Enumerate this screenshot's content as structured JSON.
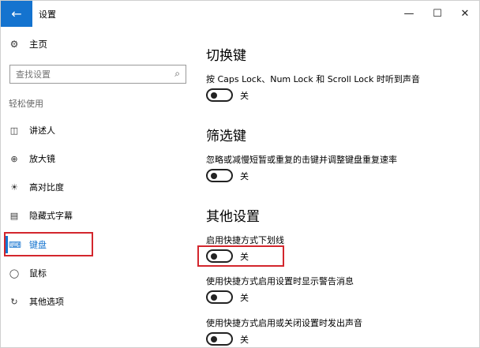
{
  "window": {
    "title": "设置",
    "back_icon": "arrow-left-icon",
    "minimize": "—",
    "maximize": "☐",
    "close": "✕"
  },
  "sidebar": {
    "home_label": "主页",
    "search_placeholder": "查找设置",
    "group_label": "轻松使用",
    "items": [
      {
        "label": "讲述人",
        "icon": "narrator-icon"
      },
      {
        "label": "放大镜",
        "icon": "magnifier-icon"
      },
      {
        "label": "高对比度",
        "icon": "contrast-icon"
      },
      {
        "label": "隐藏式字幕",
        "icon": "captions-icon"
      },
      {
        "label": "键盘",
        "icon": "keyboard-icon",
        "selected": true
      },
      {
        "label": "鼠标",
        "icon": "mouse-icon"
      },
      {
        "label": "其他选项",
        "icon": "other-options-icon"
      }
    ],
    "accent": "#1473cf"
  },
  "main": {
    "sections": [
      {
        "heading": "切换键",
        "settings": [
          {
            "desc": "按 Caps Lock、Num Lock 和 Scroll Lock 时听到声音",
            "state": "关",
            "on": false
          }
        ]
      },
      {
        "heading": "筛选键",
        "settings": [
          {
            "desc": "忽略或减慢短暂或重复的击键并调整键盘重复速率",
            "state": "关",
            "on": false
          }
        ]
      },
      {
        "heading": "其他设置",
        "settings": [
          {
            "desc": "启用快捷方式下划线",
            "state": "关",
            "on": false
          },
          {
            "desc": "使用快捷方式启用设置时显示警告消息",
            "state": "关",
            "on": false
          },
          {
            "desc": "使用快捷方式启用或关闭设置时发出声音",
            "state": "关",
            "on": false
          }
        ]
      }
    ]
  },
  "annotation_color": "#d3262d"
}
